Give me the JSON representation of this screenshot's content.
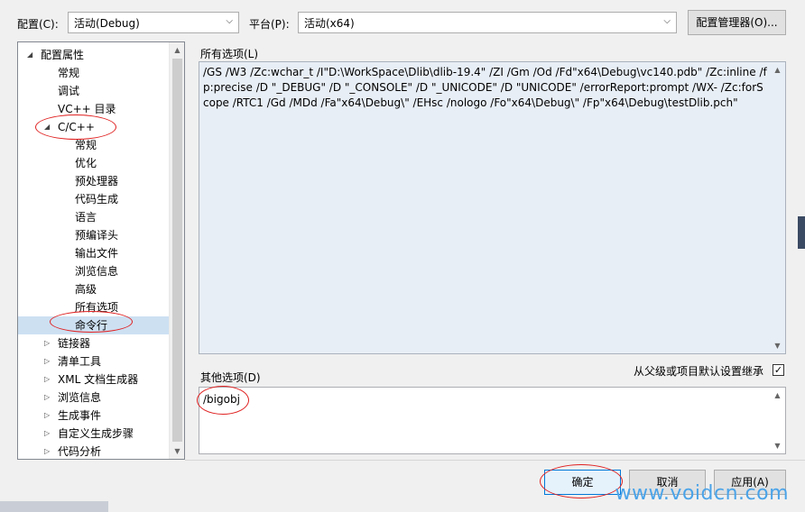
{
  "config_bar": {
    "config_label": "配置(C):",
    "config_value": "活动(Debug)",
    "platform_label": "平台(P):",
    "platform_value": "活动(x64)",
    "config_manager_button": "配置管理器(O)..."
  },
  "tree": {
    "items": [
      {
        "label": "配置属性",
        "toggle": "◢"
      },
      {
        "label": "常规"
      },
      {
        "label": "调试"
      },
      {
        "label": "VC++ 目录"
      },
      {
        "label": "C/C++",
        "toggle": "◢"
      },
      {
        "label": "常规"
      },
      {
        "label": "优化"
      },
      {
        "label": "预处理器"
      },
      {
        "label": "代码生成"
      },
      {
        "label": "语言"
      },
      {
        "label": "预编译头"
      },
      {
        "label": "输出文件"
      },
      {
        "label": "浏览信息"
      },
      {
        "label": "高级"
      },
      {
        "label": "所有选项"
      },
      {
        "label": "命令行"
      },
      {
        "label": "链接器",
        "toggle": "▷"
      },
      {
        "label": "清单工具",
        "toggle": "▷"
      },
      {
        "label": "XML 文档生成器",
        "toggle": "▷"
      },
      {
        "label": "浏览信息",
        "toggle": "▷"
      },
      {
        "label": "生成事件",
        "toggle": "▷"
      },
      {
        "label": "自定义生成步骤",
        "toggle": "▷"
      },
      {
        "label": "代码分析",
        "toggle": "▷"
      }
    ]
  },
  "all_options": {
    "label": "所有选项(L)",
    "text": "/GS /W3 /Zc:wchar_t /I\"D:\\WorkSpace\\Dlib\\dlib-19.4\" /ZI /Gm /Od /Fd\"x64\\Debug\\vc140.pdb\" /Zc:inline /fp:precise /D \"_DEBUG\" /D \"_CONSOLE\" /D \"_UNICODE\" /D \"UNICODE\" /errorReport:prompt /WX- /Zc:forScope /RTC1 /Gd /MDd /Fa\"x64\\Debug\\\" /EHsc /nologo /Fo\"x64\\Debug\\\" /Fp\"x64\\Debug\\testDlib.pch\""
  },
  "other_options": {
    "label": "其他选项(D)",
    "inherit_label": "从父级或项目默认设置继承",
    "inherit_checked": "✓",
    "value": "/bigobj"
  },
  "buttons": {
    "ok": "确定",
    "cancel": "取消",
    "apply": "应用(A)"
  },
  "watermark": "www.voidcn.com",
  "colors": {
    "selection": "#cde0f2",
    "annotation": "#e02020",
    "watermark": "#4aa3e8"
  }
}
